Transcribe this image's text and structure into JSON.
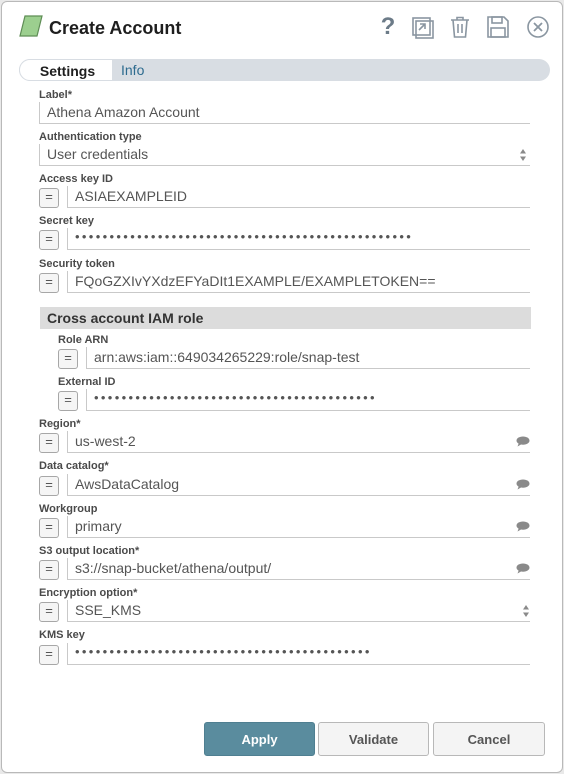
{
  "dialog": {
    "title": "Create Account"
  },
  "tabs": [
    {
      "label": "Settings"
    },
    {
      "label": "Info"
    }
  ],
  "form": {
    "label": {
      "label": "Label*",
      "value": "Athena Amazon Account"
    },
    "auth_type": {
      "label": "Authentication type",
      "value": "User credentials"
    },
    "access_key_id": {
      "label": "Access key ID",
      "value": "ASIAEXAMPLEID"
    },
    "secret_key": {
      "label": "Secret key",
      "value": "•••••••••••••••••••••••••••••••••••••••••••••••••"
    },
    "security_token": {
      "label": "Security token",
      "value": "FQoGZXIvYXdzEFYaDIt1EXAMPLE/EXAMPLETOKEN=="
    },
    "cross_account_section": {
      "title": "Cross account IAM role"
    },
    "role_arn": {
      "label": "Role ARN",
      "value": "arn:aws:iam::649034265229:role/snap-test"
    },
    "external_id": {
      "label": "External ID",
      "value": "•••••••••••••••••••••••••••••••••••••••••"
    },
    "region": {
      "label": "Region*",
      "value": "us-west-2"
    },
    "data_catalog": {
      "label": "Data catalog*",
      "value": "AwsDataCatalog"
    },
    "workgroup": {
      "label": "Workgroup",
      "value": "primary"
    },
    "s3_output_location": {
      "label": "S3 output location*",
      "value": "s3://snap-bucket/athena/output/"
    },
    "encryption_option": {
      "label": "Encryption option*",
      "value": "SSE_KMS"
    },
    "kms_key": {
      "label": "KMS key",
      "value": "•••••••••••••••••••••••••••••••••••••••••••"
    },
    "expression_toggle": "="
  },
  "footer": {
    "apply": "Apply",
    "validate": "Validate",
    "cancel": "Cancel"
  },
  "icons": {
    "header": [
      "snap-icon",
      "help-icon",
      "export-icon",
      "trash-icon",
      "save-icon",
      "close-icon"
    ],
    "fields": [
      "expression-toggle",
      "spinner-icon",
      "suggest-bubble-icon"
    ]
  },
  "colors": {
    "primary_button": "#5a8c9e",
    "snap_icon": "#9ccf8f",
    "tab_link": "#2d6b8f",
    "section_bg": "#dcdcdc",
    "header_icons": "#6c7b88"
  }
}
